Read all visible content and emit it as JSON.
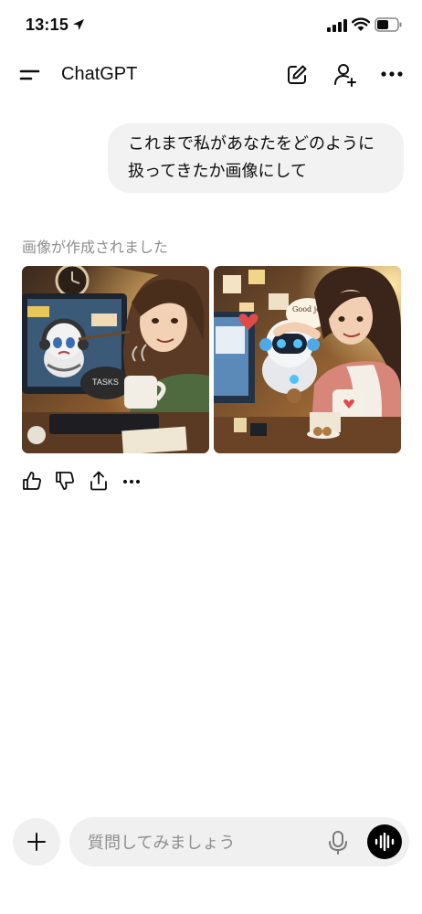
{
  "status_bar": {
    "time": "13:15",
    "icons": [
      "location-arrow-icon",
      "signal-icon",
      "wifi-icon",
      "battery-icon"
    ]
  },
  "header": {
    "title": "ChatGPT",
    "icons": [
      "menu-icon",
      "new-chat-icon",
      "add-user-icon",
      "more-icon"
    ]
  },
  "conversation": {
    "user_message": "これまで私があなたをどのように扱ってきたか画像にして",
    "assistant": {
      "status": "画像が作成されました",
      "images": [
        {
          "name": "generated-image-1",
          "texts": [
            "TASKS"
          ]
        },
        {
          "name": "generated-image-2",
          "texts": [
            "Good job!"
          ]
        }
      ],
      "actions": [
        "thumbs-up-icon",
        "thumbs-down-icon",
        "share-icon",
        "more-icon"
      ]
    }
  },
  "composer": {
    "placeholder": "質問してみましょう",
    "icons": [
      "plus-icon",
      "mic-icon",
      "voice-mode-icon"
    ]
  },
  "colors": {
    "bubble_bg": "#f2f2f2",
    "muted_text": "#8e8e8e",
    "input_bg": "#f0f0f0",
    "voice_button": "#000000"
  }
}
